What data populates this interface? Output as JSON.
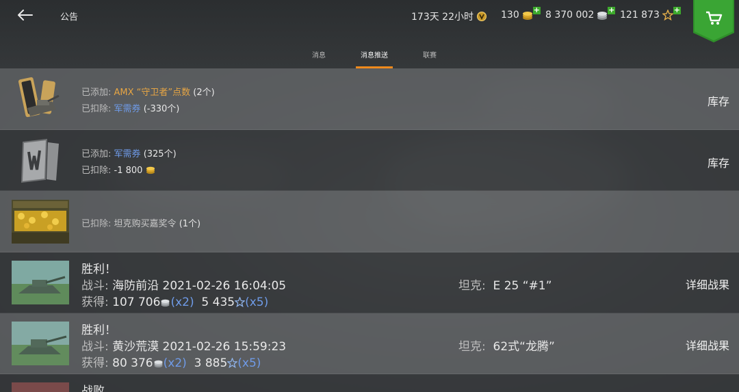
{
  "header": {
    "title": "公告",
    "premium_time": "173天 22小时",
    "gold": "130",
    "credits": "8 370 002",
    "free_xp": "121 873"
  },
  "tabs": [
    {
      "label": "消息",
      "active": false
    },
    {
      "label": "消息推送",
      "active": true
    },
    {
      "label": "联赛",
      "active": false
    }
  ],
  "colors": {
    "accent": "#f08a1c",
    "shop": "#2f8f2a",
    "highlight_orange": "#e6a544",
    "link_blue": "#6f9be8"
  },
  "messages": [
    {
      "icon": "amx-guardian-points-icon",
      "added_label": "已添加:",
      "added_item": "AMX “守卫者”点数",
      "added_count": "(2个)",
      "removed_label": "已扣除:",
      "removed_item": "军需券",
      "removed_count": "(-330个)",
      "action": "库存"
    },
    {
      "icon": "supply-coupon-icon",
      "added_label": "已添加:",
      "added_item": "军需券",
      "added_count": "(325个)",
      "removed_label": "已扣除:",
      "removed_amount": "-1 800",
      "action": "库存"
    },
    {
      "icon": "gold-chest-icon",
      "removed_label": "已扣除:",
      "removed_item": "坦克购买嘉奖令",
      "removed_count": "(1个)"
    }
  ],
  "battles": [
    {
      "result": "胜利！",
      "battle_label": "战斗:",
      "map": "海防前沿",
      "datetime": "2021-02-26 16:04:05",
      "earned_label": "获得:",
      "credits": "107 706",
      "credits_mult": "(x2)",
      "xp": "5 435",
      "xp_mult": "(x5)",
      "tank_label": "坦克:",
      "tank": "E 25 “#1”",
      "action": "详细战果"
    },
    {
      "result": "胜利！",
      "battle_label": "战斗:",
      "map": "黄沙荒漠",
      "datetime": "2021-02-26 15:59:23",
      "earned_label": "获得:",
      "credits": "80 376",
      "credits_mult": "(x2)",
      "xp": "3 885",
      "xp_mult": "(x5)",
      "tank_label": "坦克:",
      "tank": "62式“龙腾”",
      "action": "详细战果"
    },
    {
      "result": "战败"
    }
  ]
}
